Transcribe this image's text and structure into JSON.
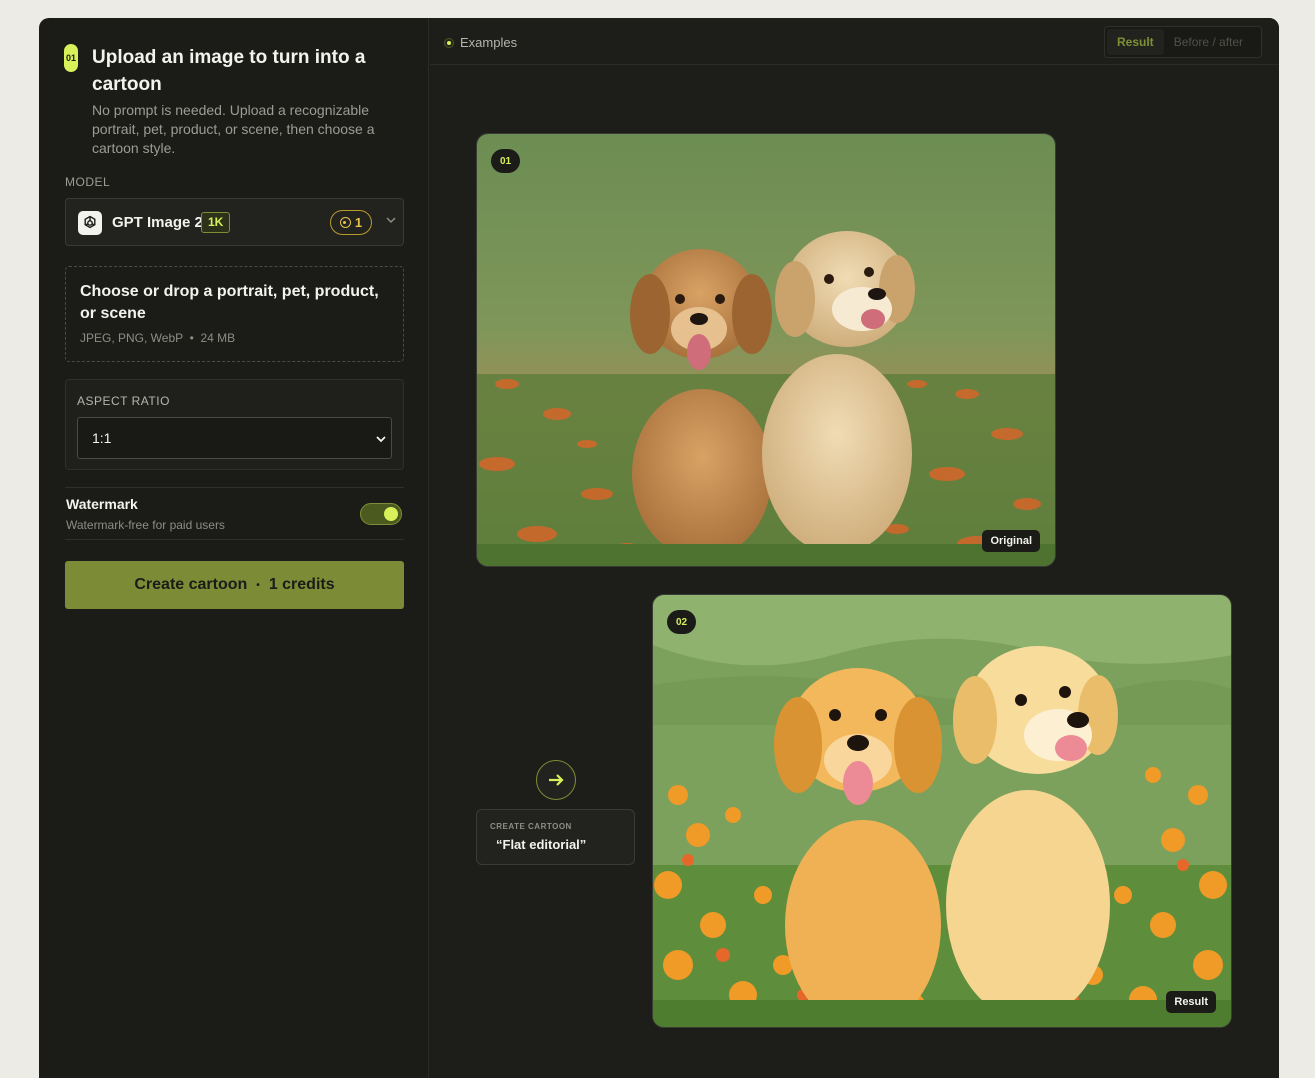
{
  "sidebar": {
    "step_number": "01",
    "title": "Upload an image to turn into a cartoon",
    "description": "No prompt is needed. Upload a recognizable portrait, pet, product, or scene, then choose a cartoon style.",
    "model_label": "MODEL",
    "model": {
      "name": "GPT Image 2",
      "resolution_badge": "1K",
      "credit_cost": "1",
      "icon": "openai-icon"
    },
    "dropzone": {
      "title": "Choose or drop a portrait, pet, product, or scene",
      "formats": "JPEG, PNG, WebP",
      "separator": "•",
      "max_size": "24 MB"
    },
    "aspect_ratio": {
      "label": "ASPECT RATIO",
      "value": "1:1"
    },
    "watermark": {
      "title": "Watermark",
      "subtitle": "Watermark-free for paid users",
      "enabled": true
    },
    "create_button": {
      "label": "Create cartoon",
      "separator": "•",
      "credits": "1 credits"
    }
  },
  "examples": {
    "header_label": "Examples",
    "view_toggle": {
      "options": [
        "Result",
        "Before / after"
      ],
      "selected": "Result"
    },
    "original_card": {
      "number": "01",
      "label": "Original"
    },
    "result_card": {
      "number": "02",
      "label": "Result"
    },
    "arrow_icon": "arrow-right-icon",
    "style": {
      "kicker": "CREATE CARTOON",
      "name": "“Flat editorial”"
    }
  },
  "colors": {
    "accent": "#d8f05a",
    "button": "#7c8c36",
    "panel": "#1b1c18",
    "coin": "#e8c14a"
  }
}
